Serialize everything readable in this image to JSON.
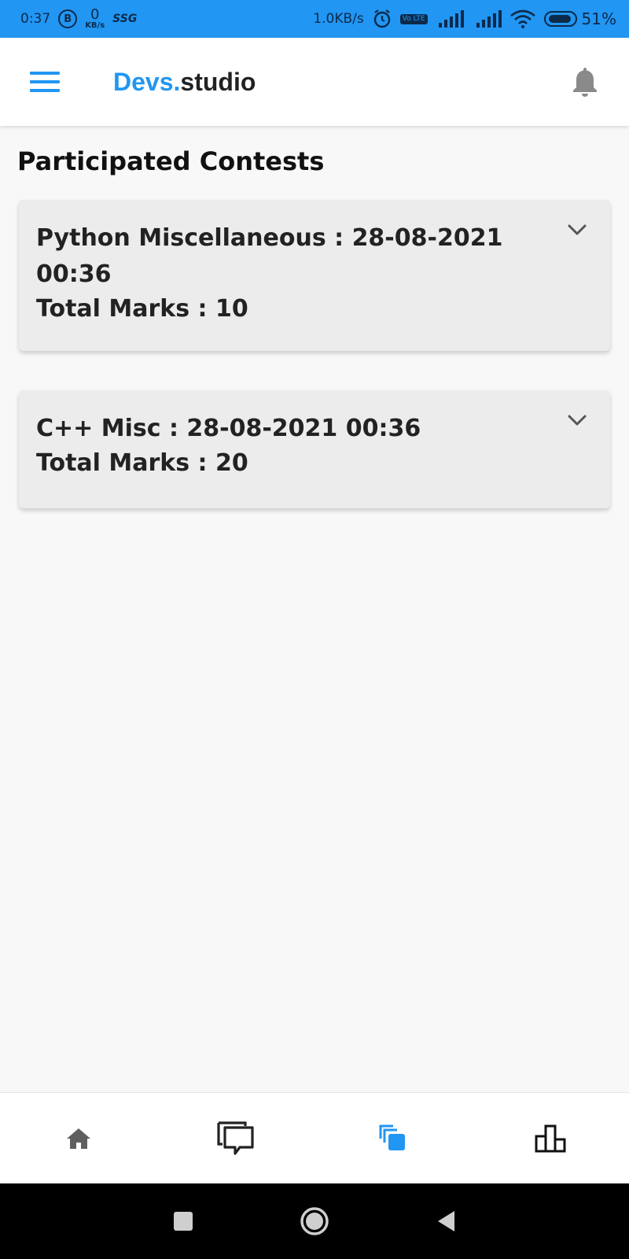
{
  "status_bar": {
    "time": "0:37",
    "b_badge": "B",
    "net_speed_value": "0",
    "net_speed_unit": "KB/s",
    "ssg": "SSG",
    "right_speed": "1.0KB/s",
    "volte": "Vo LTE",
    "battery": "51%"
  },
  "app_bar": {
    "brand_part1": "Devs.",
    "brand_part2": "studio"
  },
  "page": {
    "title": "Participated Contests"
  },
  "contests": [
    {
      "name": "Python Miscellaneous",
      "separator": " : ",
      "date": "28-08-2021 00:36",
      "marks_label": "Total Marks : ",
      "marks": "10"
    },
    {
      "name": "C++ Misc",
      "separator": " : ",
      "date": "28-08-2021 00:36",
      "marks_label": "Total Marks : ",
      "marks": "20"
    }
  ],
  "bottom_nav": {
    "active_index": 2,
    "items": [
      "home-icon",
      "chat-icon",
      "contests-icon",
      "leaderboard-icon"
    ]
  },
  "colors": {
    "accent": "#2196f3",
    "card_bg": "#ececec",
    "inactive_icon": "#5f5f5f"
  }
}
